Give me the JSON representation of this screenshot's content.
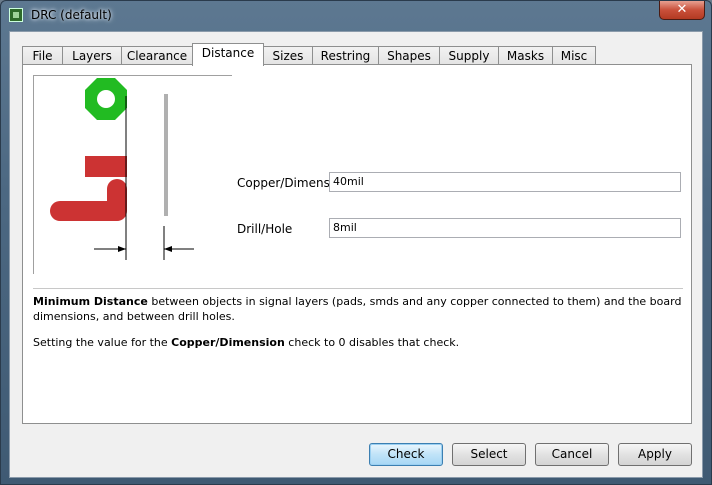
{
  "window": {
    "title": "DRC (default)"
  },
  "tabs": [
    {
      "label": "File"
    },
    {
      "label": "Layers"
    },
    {
      "label": "Clearance"
    },
    {
      "label": "Distance",
      "active": true
    },
    {
      "label": "Sizes"
    },
    {
      "label": "Restring"
    },
    {
      "label": "Shapes"
    },
    {
      "label": "Supply"
    },
    {
      "label": "Masks"
    },
    {
      "label": "Misc"
    }
  ],
  "fields": {
    "copper_dimension": {
      "label": "Copper/Dimension",
      "value": "40mil"
    },
    "drill_hole": {
      "label": "Drill/Hole",
      "value": "8mil"
    }
  },
  "description": {
    "line1_bold": "Minimum Distance",
    "line1_rest": " between objects in signal layers (pads, smds and any copper connected to them) and the board dimensions, and between drill holes.",
    "line2_pre": "Setting the value for the ",
    "line2_bold": "Copper/Dimension",
    "line2_post": " check to 0 disables that check."
  },
  "buttons": {
    "check": "Check",
    "select": "Select",
    "cancel": "Cancel",
    "apply": "Apply"
  },
  "colors": {
    "pad_green": "#22bb22",
    "trace_red": "#cc3333",
    "dimension_gray": "#b0b0b0"
  }
}
